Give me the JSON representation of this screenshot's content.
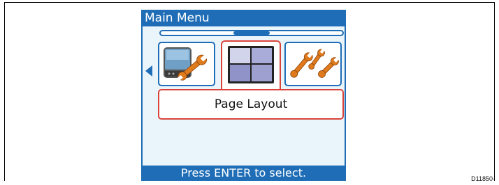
{
  "screen": {
    "title": "Main Menu",
    "selected_item_label": "Page Layout",
    "status": "Press ENTER to select.",
    "menu_items": [
      {
        "icon": "display-setup-icon"
      },
      {
        "icon": "page-layout-icon"
      },
      {
        "icon": "tools-icon"
      }
    ],
    "colors": {
      "accent": "#1e6db6",
      "selection": "#d9433a",
      "background": "#eaf4fb"
    }
  },
  "figure_code": "D11850-"
}
